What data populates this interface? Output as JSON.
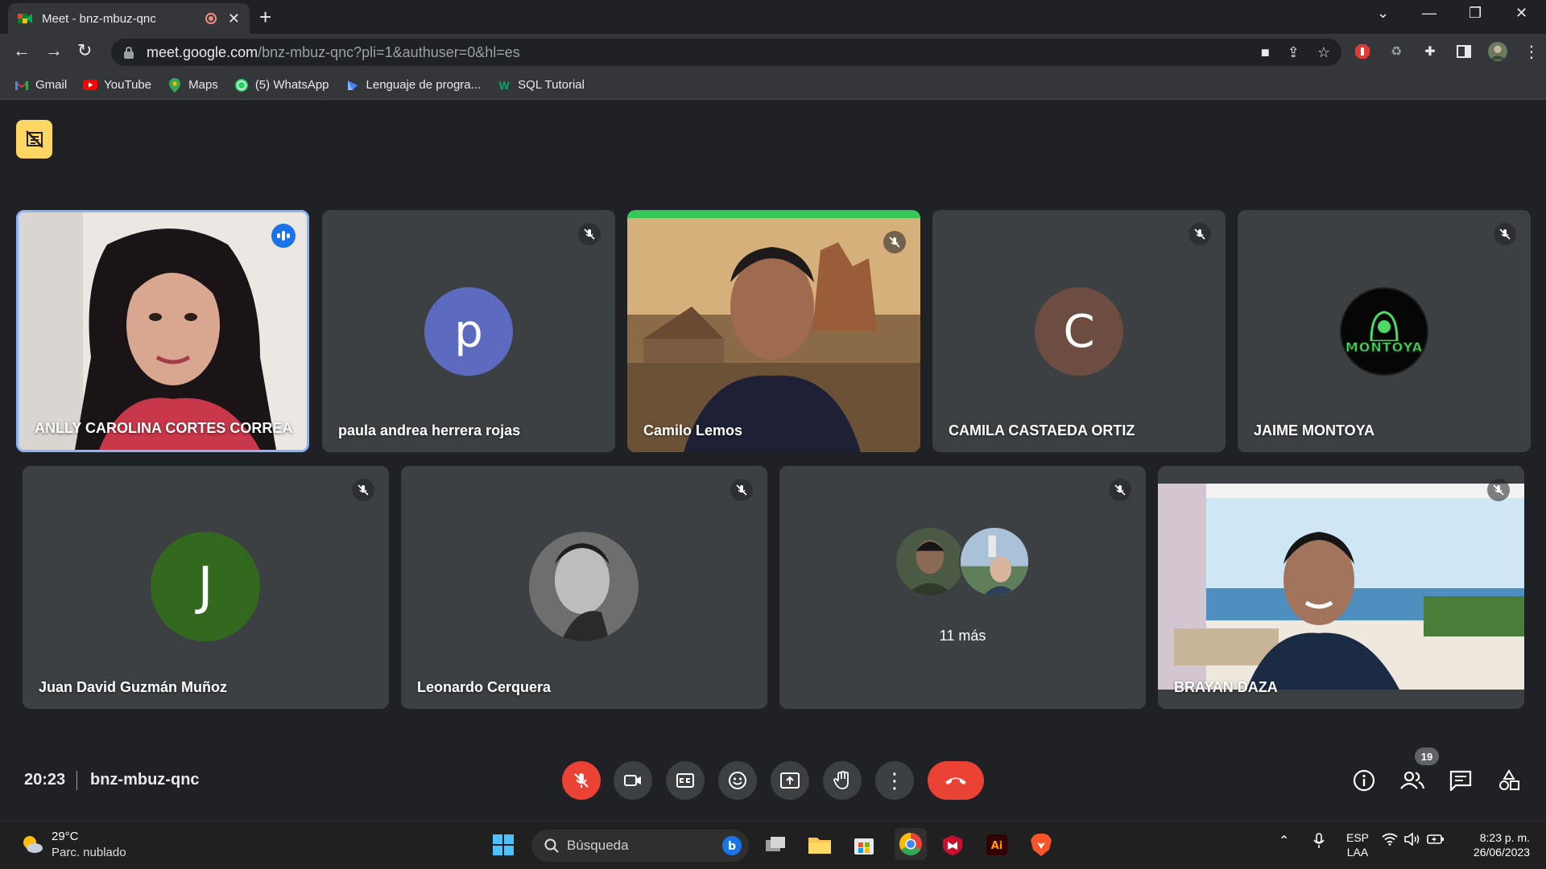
{
  "browser": {
    "tab_title": "Meet - bnz-mbuz-qnc",
    "url_host": "meet.google.com",
    "url_path": "/bnz-mbuz-qnc?pli=1&authuser=0&hl=es",
    "bookmarks": [
      {
        "label": "Gmail",
        "icon": "gmail-icon",
        "color": "#ea4335"
      },
      {
        "label": "YouTube",
        "icon": "youtube-icon",
        "color": "#ff0000"
      },
      {
        "label": "Maps",
        "icon": "maps-icon",
        "color": "#34a853"
      },
      {
        "label": "(5) WhatsApp",
        "icon": "whatsapp-icon",
        "color": "#25d366"
      },
      {
        "label": "Lenguaje de progra...",
        "icon": "lenguaje-icon",
        "color": "#4285f4"
      },
      {
        "label": "SQL Tutorial",
        "icon": "w3schools-icon",
        "color": "#04aa6d"
      }
    ]
  },
  "meet": {
    "participants": [
      {
        "name": "ANLLY CAROLINA CORTES CORREA",
        "speaking": true,
        "media": "video"
      },
      {
        "name": "paula andrea herrera rojas",
        "initial": "p",
        "avatar_color": "#5c6bc0",
        "muted": true
      },
      {
        "name": "Camilo Lemos",
        "muted": true,
        "media": "video"
      },
      {
        "name": "CAMILA CASTAEDA ORTIZ",
        "initial": "C",
        "avatar_color": "#6d4c41",
        "muted": true
      },
      {
        "name": "JAIME MONTOYA",
        "logo_text": "MONTOYA",
        "muted": true
      },
      {
        "name": "Juan David Guzmán Muñoz",
        "initial": "J",
        "avatar_color": "#33691e",
        "muted": true
      },
      {
        "name": "Leonardo Cerquera",
        "muted": true,
        "media": "photo"
      },
      {
        "more_label": "11 más",
        "muted": true
      },
      {
        "name": "BRAYAN DAZA",
        "muted": true,
        "media": "video"
      }
    ],
    "time": "20:23",
    "meeting_code": "bnz-mbuz-qnc",
    "participant_count": "19"
  },
  "taskbar": {
    "weather_temp": "29°C",
    "weather_desc": "Parc. nublado",
    "search_label": "Búsqueda",
    "lang_line1": "ESP",
    "lang_line2": "LAA",
    "clock_time": "8:23 p. m.",
    "clock_date": "26/06/2023"
  }
}
